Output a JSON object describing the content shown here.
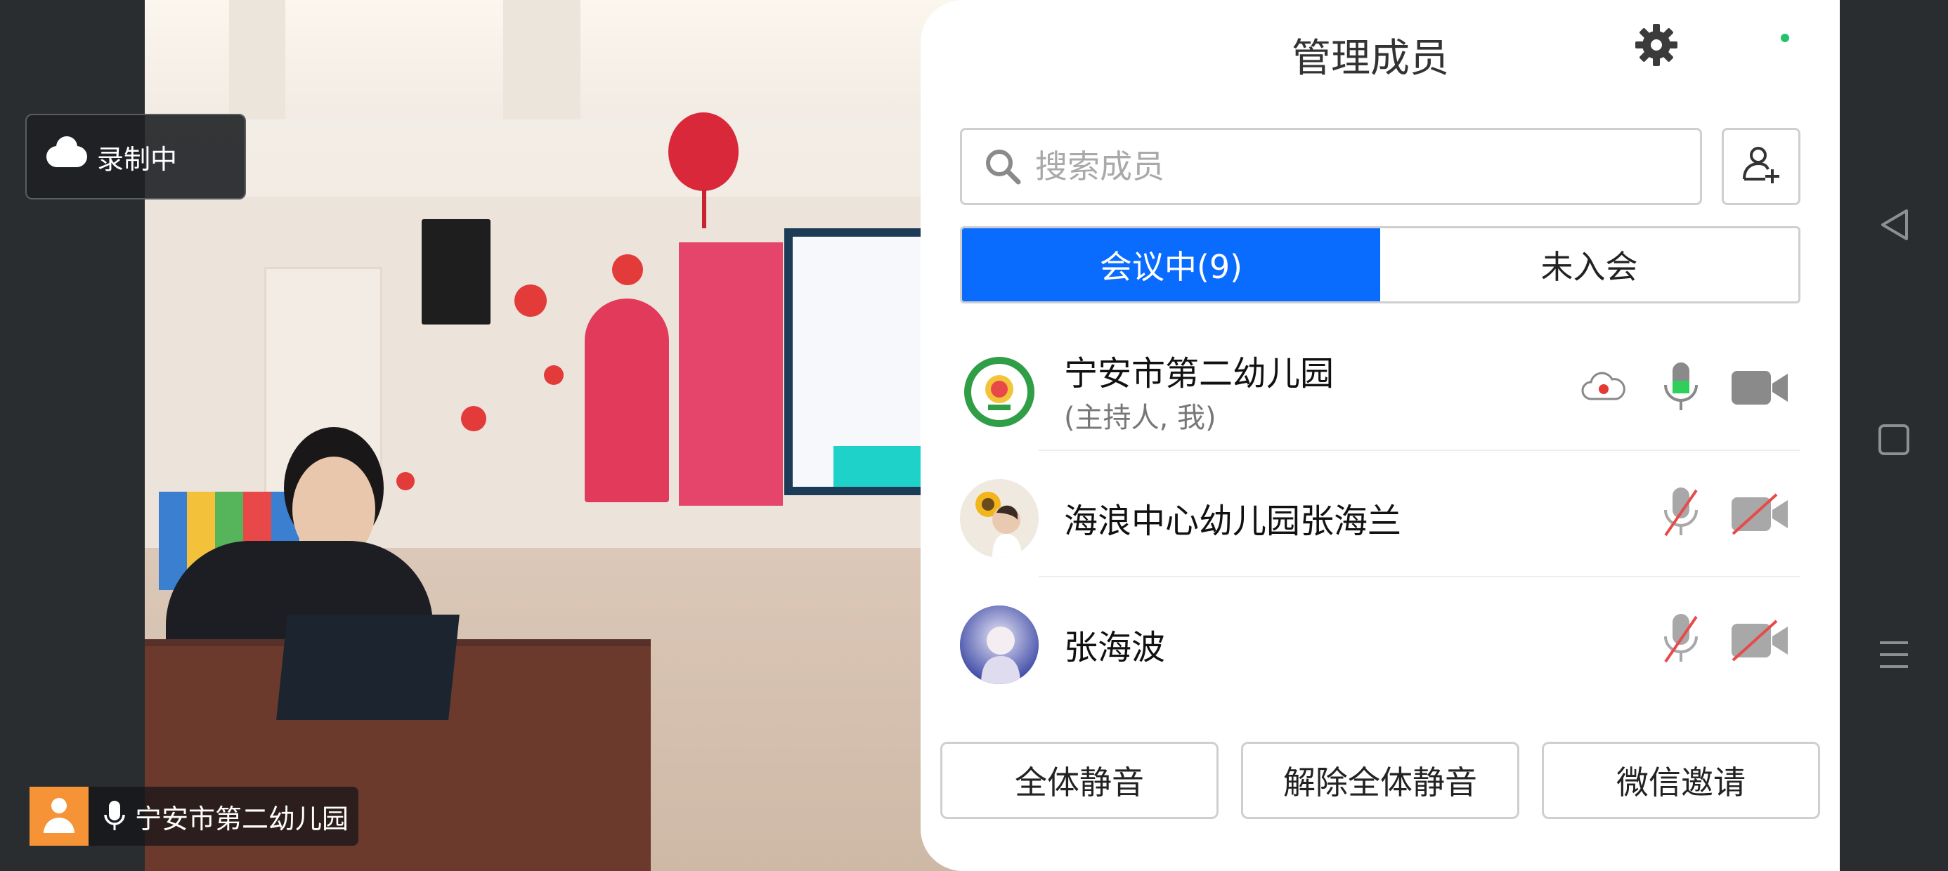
{
  "recording": {
    "label": "录制中",
    "icon": "cloud-icon"
  },
  "speaker": {
    "name": "宁安市第二幼儿园",
    "icons": [
      "person-icon",
      "mic-icon"
    ]
  },
  "panel": {
    "title": "管理成员",
    "search_placeholder": "搜索成员",
    "tabs": [
      {
        "label": "会议中(9)",
        "active": true
      },
      {
        "label": "未入会",
        "active": false
      }
    ],
    "members": [
      {
        "name": "宁安市第二幼儿园",
        "subtitle": "(主持人, 我)",
        "recording": true,
        "mic": "on",
        "camera": "on"
      },
      {
        "name": "海浪中心幼儿园张海兰",
        "subtitle": "",
        "recording": false,
        "mic": "off",
        "camera": "off"
      },
      {
        "name": "张海波",
        "subtitle": "",
        "recording": false,
        "mic": "off",
        "camera": "off"
      }
    ],
    "buttons": {
      "mute_all": "全体静音",
      "unmute_all": "解除全体静音",
      "wechat_invite": "微信邀请"
    }
  },
  "colors": {
    "accent": "#0a6cff",
    "mic_active": "#2ecf5a",
    "muted_slash": "#e84a4a",
    "avatar_orange": "#f59336"
  }
}
